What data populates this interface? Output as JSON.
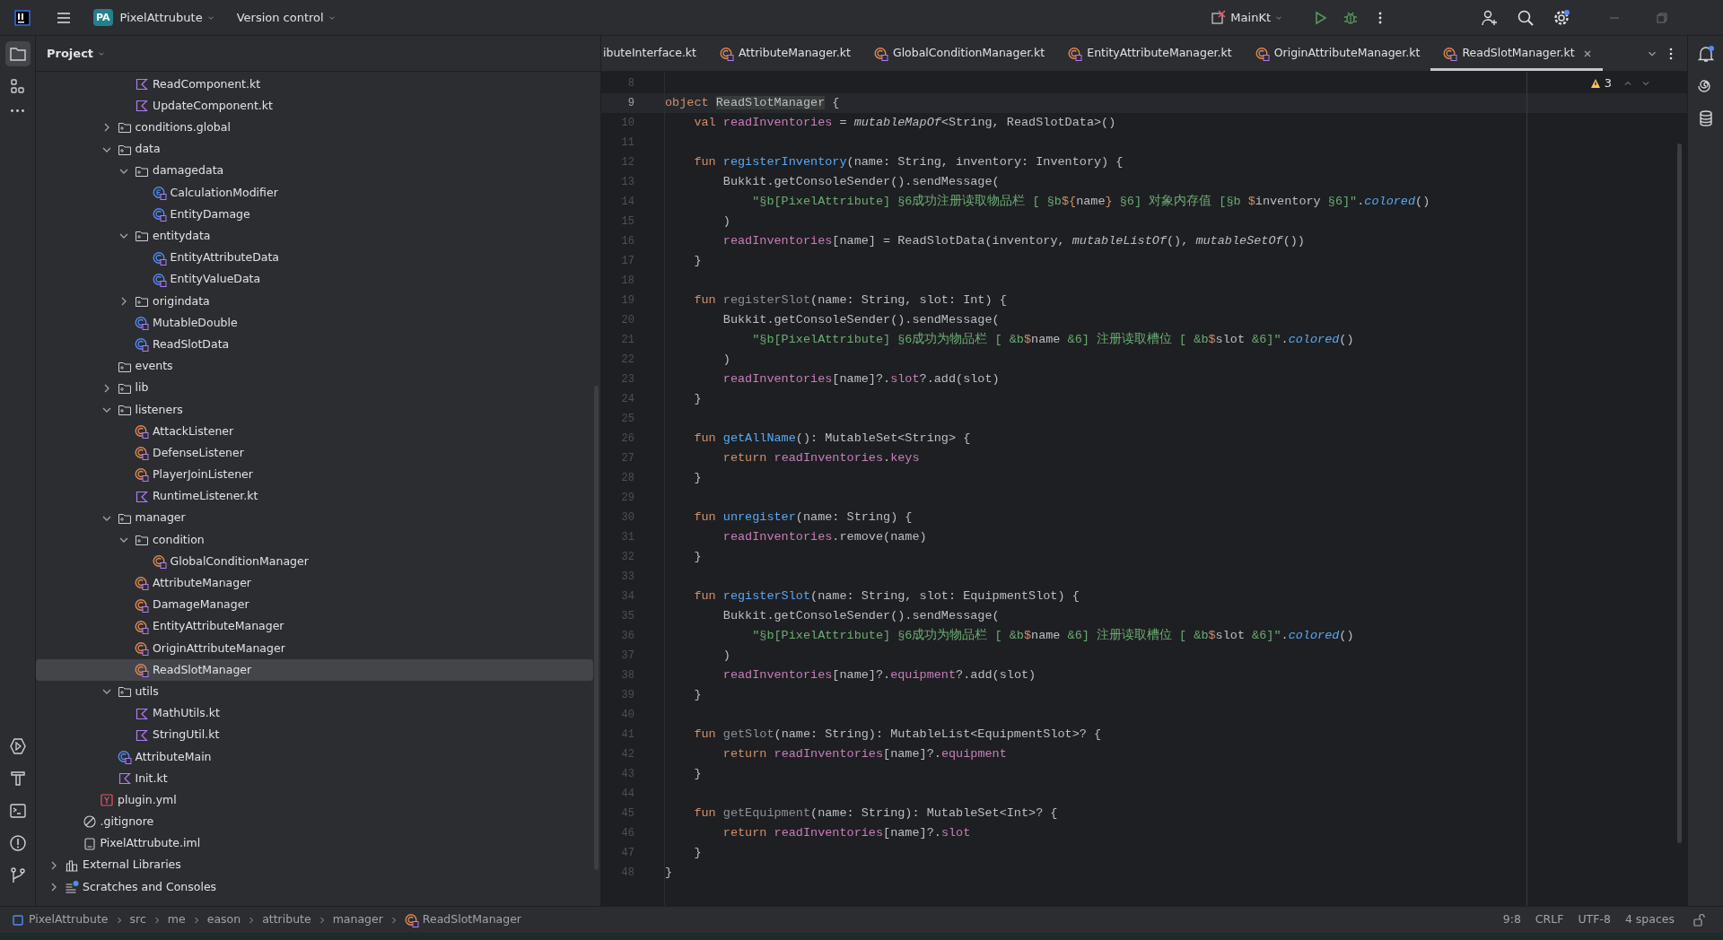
{
  "title_bar": {
    "project_badge": "PA",
    "project_name": "PixelAttrubute",
    "vcs": "Version control",
    "run_config": "MainKt",
    "settings_badge": true
  },
  "tool_strip": {
    "top": [
      {
        "kind": "project",
        "selected": true
      },
      {
        "kind": "structure",
        "selected": false
      },
      {
        "kind": "more",
        "selected": false
      }
    ],
    "bottom": [
      {
        "kind": "run",
        "selected": false
      },
      {
        "kind": "build",
        "selected": false
      },
      {
        "kind": "terminal",
        "selected": false
      },
      {
        "kind": "problems",
        "selected": false
      },
      {
        "kind": "git",
        "selected": false
      }
    ]
  },
  "project_panel": {
    "title": "Project",
    "tree": [
      {
        "children": [
          {
            "children": [
              {
                "children": [
                  {
                    "children": [
                      {
                        "label": "ReadComponent.kt",
                        "kind": "kotlin",
                        "selected": false
                      },
                      {
                        "label": "UpdateComponent.kt",
                        "kind": "kotlin",
                        "selected": false
                      }
                    ]
                  },
                  {
                    "label": "conditions.global",
                    "kind": "folder",
                    "expanded": false,
                    "selected": false
                  },
                  {
                    "label": "data",
                    "kind": "folder",
                    "expanded": true,
                    "selected": false,
                    "children": [
                      {
                        "label": "damagedata",
                        "kind": "folder",
                        "expanded": true,
                        "selected": false,
                        "children": [
                          {
                            "label": "CalculationModifier",
                            "kind": "enum",
                            "selected": false
                          },
                          {
                            "label": "EntityDamage",
                            "kind": "class",
                            "selected": false
                          }
                        ]
                      },
                      {
                        "label": "entitydata",
                        "kind": "folder",
                        "expanded": true,
                        "selected": false,
                        "children": [
                          {
                            "label": "EntityAttributeData",
                            "kind": "class",
                            "selected": false
                          },
                          {
                            "label": "EntityValueData",
                            "kind": "class",
                            "selected": false
                          }
                        ]
                      },
                      {
                        "label": "origindata",
                        "kind": "folder",
                        "expanded": false,
                        "selected": false
                      },
                      {
                        "label": "MutableDouble",
                        "kind": "class",
                        "selected": false
                      },
                      {
                        "label": "ReadSlotData",
                        "kind": "class",
                        "selected": false
                      }
                    ]
                  },
                  {
                    "label": "events",
                    "kind": "folder",
                    "selected": false
                  },
                  {
                    "label": "lib",
                    "kind": "folder",
                    "expanded": false,
                    "selected": false
                  },
                  {
                    "label": "listeners",
                    "kind": "folder",
                    "expanded": true,
                    "selected": false,
                    "children": [
                      {
                        "label": "AttackListener",
                        "kind": "object",
                        "selected": false
                      },
                      {
                        "label": "DefenseListener",
                        "kind": "object",
                        "selected": false
                      },
                      {
                        "label": "PlayerJoinListener",
                        "kind": "object",
                        "selected": false
                      },
                      {
                        "label": "RuntimeListener.kt",
                        "kind": "kotlin",
                        "selected": false
                      }
                    ]
                  },
                  {
                    "label": "manager",
                    "kind": "folder",
                    "expanded": true,
                    "selected": false,
                    "children": [
                      {
                        "label": "condition",
                        "kind": "folder",
                        "expanded": true,
                        "selected": false,
                        "children": [
                          {
                            "label": "GlobalConditionManager",
                            "kind": "object",
                            "selected": false
                          }
                        ]
                      },
                      {
                        "label": "AttributeManager",
                        "kind": "object",
                        "selected": false
                      },
                      {
                        "label": "DamageManager",
                        "kind": "object",
                        "selected": false
                      },
                      {
                        "label": "EntityAttributeManager",
                        "kind": "object",
                        "selected": false
                      },
                      {
                        "label": "OriginAttributeManager",
                        "kind": "object",
                        "selected": false
                      },
                      {
                        "label": "ReadSlotManager",
                        "kind": "object",
                        "selected": true
                      }
                    ]
                  },
                  {
                    "label": "utils",
                    "kind": "folder",
                    "expanded": true,
                    "selected": false,
                    "children": [
                      {
                        "label": "MathUtils.kt",
                        "kind": "kotlin",
                        "selected": false
                      },
                      {
                        "label": "StringUtil.kt",
                        "kind": "kotlin",
                        "selected": false
                      }
                    ]
                  },
                  {
                    "label": "AttributeMain",
                    "kind": "class",
                    "selected": false
                  },
                  {
                    "label": "Init.kt",
                    "kind": "kotlin",
                    "selected": false
                  }
                ]
              },
              {
                "label": "plugin.yml",
                "kind": "yml",
                "selected": false
              }
            ]
          },
          {
            "label": ".gitignore",
            "kind": "ignore",
            "selected": false
          },
          {
            "label": "PixelAttrubute.iml",
            "kind": "iml",
            "selected": false
          }
        ]
      },
      {
        "label": "External Libraries",
        "kind": "libraries",
        "expanded": false,
        "selected": false
      },
      {
        "label": "Scratches and Consoles",
        "kind": "scratches",
        "expanded": false,
        "selected": false
      }
    ]
  },
  "editor": {
    "tabs": [
      {
        "label": "ibuteInterface.kt",
        "selected": false
      },
      {
        "label": "AttributeManager.kt",
        "kind": "object",
        "selected": false
      },
      {
        "label": "GlobalConditionManager.kt",
        "kind": "object",
        "selected": false
      },
      {
        "label": "EntityAttributeManager.kt",
        "kind": "object",
        "selected": false
      },
      {
        "label": "OriginAttributeManager.kt",
        "kind": "object",
        "selected": false
      },
      {
        "label": "ReadSlotManager.kt",
        "kind": "object",
        "selected": true
      }
    ],
    "warnings": "3",
    "lines": [
      {
        "number": "8",
        "current": false
      },
      {
        "number": "9",
        "current": true,
        "tokens": [
          {
            "text": "object ",
            "kind": "keyword"
          },
          {
            "text": "ReadSlotManager",
            "kind": "declared"
          },
          {
            "text": " {",
            "kind": "plain"
          }
        ]
      },
      {
        "number": "10",
        "current": false,
        "tokens": [
          {
            "text": "    val ",
            "kind": "keyword"
          },
          {
            "text": "readInventories",
            "kind": "property"
          },
          {
            "text": " = ",
            "kind": "plain"
          },
          {
            "text": "mutableMapOf",
            "kind": "italic"
          },
          {
            "text": "<String, ReadSlotData>()",
            "kind": "plain"
          }
        ]
      },
      {
        "number": "11",
        "current": false
      },
      {
        "number": "12",
        "current": false,
        "tokens": [
          {
            "text": "    fun ",
            "kind": "keyword"
          },
          {
            "text": "registerInventory",
            "kind": "function"
          },
          {
            "text": "(name: String, inventory: Inventory) {",
            "kind": "plain"
          }
        ]
      },
      {
        "number": "13",
        "current": false,
        "tokens": [
          {
            "text": "        Bukkit.getConsoleSender().sendMessage(",
            "kind": "plain"
          }
        ]
      },
      {
        "number": "14",
        "current": false,
        "tokens": [
          {
            "text": "            \"§b[PixelAttribute] §6成功注册读取物品栏 [ §b",
            "kind": "string"
          },
          {
            "text": "${",
            "kind": "template"
          },
          {
            "text": "name",
            "kind": "plain"
          },
          {
            "text": "}",
            "kind": "template"
          },
          {
            "text": " §6] 对象内存值 [§b ",
            "kind": "string"
          },
          {
            "text": "$",
            "kind": "template"
          },
          {
            "text": "inventory",
            "kind": "plain"
          },
          {
            "text": " §6]\"",
            "kind": "string"
          },
          {
            "text": ".",
            "kind": "plain"
          },
          {
            "text": "colored",
            "kind": "call"
          },
          {
            "text": "()",
            "kind": "plain"
          }
        ]
      },
      {
        "number": "15",
        "current": false,
        "tokens": [
          {
            "text": "        )",
            "kind": "plain"
          }
        ]
      },
      {
        "number": "16",
        "current": false,
        "tokens": [
          {
            "text": "        readInventories",
            "kind": "property"
          },
          {
            "text": "[name] = ReadSlotData(inventory, ",
            "kind": "plain"
          },
          {
            "text": "mutableListOf",
            "kind": "italic"
          },
          {
            "text": "(), ",
            "kind": "plain"
          },
          {
            "text": "mutableSetOf",
            "kind": "italic"
          },
          {
            "text": "())",
            "kind": "plain"
          }
        ]
      },
      {
        "number": "17",
        "current": false,
        "tokens": [
          {
            "text": "    }",
            "kind": "plain"
          }
        ]
      },
      {
        "number": "18",
        "current": false
      },
      {
        "number": "19",
        "current": false,
        "tokens": [
          {
            "text": "    fun ",
            "kind": "keyword"
          },
          {
            "text": "registerSlot",
            "kind": "unused"
          },
          {
            "text": "(name: String, slot: Int) {",
            "kind": "plain"
          }
        ]
      },
      {
        "number": "20",
        "current": false,
        "tokens": [
          {
            "text": "        Bukkit.getConsoleSender().sendMessage(",
            "kind": "plain"
          }
        ]
      },
      {
        "number": "21",
        "current": false,
        "tokens": [
          {
            "text": "            \"§b[PixelAttribute] §6成功为物品栏 [ &b",
            "kind": "string"
          },
          {
            "text": "$",
            "kind": "template"
          },
          {
            "text": "name",
            "kind": "plain"
          },
          {
            "text": " &6] 注册读取槽位 [ &b",
            "kind": "string"
          },
          {
            "text": "$",
            "kind": "template"
          },
          {
            "text": "slot",
            "kind": "plain"
          },
          {
            "text": " &6]\"",
            "kind": "string"
          },
          {
            "text": ".",
            "kind": "plain"
          },
          {
            "text": "colored",
            "kind": "call"
          },
          {
            "text": "()",
            "kind": "plain"
          }
        ]
      },
      {
        "number": "22",
        "current": false,
        "tokens": [
          {
            "text": "        )",
            "kind": "plain"
          }
        ]
      },
      {
        "number": "23",
        "current": false,
        "tokens": [
          {
            "text": "        readInventories",
            "kind": "property"
          },
          {
            "text": "[name]?.",
            "kind": "plain"
          },
          {
            "text": "slot",
            "kind": "property"
          },
          {
            "text": "?.add(slot)",
            "kind": "plain"
          }
        ]
      },
      {
        "number": "24",
        "current": false,
        "tokens": [
          {
            "text": "    }",
            "kind": "plain"
          }
        ]
      },
      {
        "number": "25",
        "current": false
      },
      {
        "number": "26",
        "current": false,
        "tokens": [
          {
            "text": "    fun ",
            "kind": "keyword"
          },
          {
            "text": "getAllName",
            "kind": "function"
          },
          {
            "text": "(): MutableSet<String> {",
            "kind": "plain"
          }
        ]
      },
      {
        "number": "27",
        "current": false,
        "tokens": [
          {
            "text": "        return ",
            "kind": "keyword"
          },
          {
            "text": "readInventories",
            "kind": "property"
          },
          {
            "text": ".",
            "kind": "plain"
          },
          {
            "text": "keys",
            "kind": "property"
          }
        ]
      },
      {
        "number": "28",
        "current": false,
        "tokens": [
          {
            "text": "    }",
            "kind": "plain"
          }
        ]
      },
      {
        "number": "29",
        "current": false
      },
      {
        "number": "30",
        "current": false,
        "tokens": [
          {
            "text": "    fun ",
            "kind": "keyword"
          },
          {
            "text": "unregister",
            "kind": "function"
          },
          {
            "text": "(name: String) {",
            "kind": "plain"
          }
        ]
      },
      {
        "number": "31",
        "current": false,
        "tokens": [
          {
            "text": "        readInventories",
            "kind": "property"
          },
          {
            "text": ".remove(name)",
            "kind": "plain"
          }
        ]
      },
      {
        "number": "32",
        "current": false,
        "tokens": [
          {
            "text": "    }",
            "kind": "plain"
          }
        ]
      },
      {
        "number": "33",
        "current": false
      },
      {
        "number": "34",
        "current": false,
        "tokens": [
          {
            "text": "    fun ",
            "kind": "keyword"
          },
          {
            "text": "registerSlot",
            "kind": "function"
          },
          {
            "text": "(name: String, slot: EquipmentSlot) {",
            "kind": "plain"
          }
        ]
      },
      {
        "number": "35",
        "current": false,
        "tokens": [
          {
            "text": "        Bukkit.getConsoleSender().sendMessage(",
            "kind": "plain"
          }
        ]
      },
      {
        "number": "36",
        "current": false,
        "tokens": [
          {
            "text": "            \"§b[PixelAttribute] §6成功为物品栏 [ &b",
            "kind": "string"
          },
          {
            "text": "$",
            "kind": "template"
          },
          {
            "text": "name",
            "kind": "plain"
          },
          {
            "text": " &6] 注册读取槽位 [ &b",
            "kind": "string"
          },
          {
            "text": "$",
            "kind": "template"
          },
          {
            "text": "slot",
            "kind": "plain"
          },
          {
            "text": " &6]\"",
            "kind": "string"
          },
          {
            "text": ".",
            "kind": "plain"
          },
          {
            "text": "colored",
            "kind": "call"
          },
          {
            "text": "()",
            "kind": "plain"
          }
        ]
      },
      {
        "number": "37",
        "current": false,
        "tokens": [
          {
            "text": "        )",
            "kind": "plain"
          }
        ]
      },
      {
        "number": "38",
        "current": false,
        "tokens": [
          {
            "text": "        readInventories",
            "kind": "property"
          },
          {
            "text": "[name]?.",
            "kind": "plain"
          },
          {
            "text": "equipment",
            "kind": "property"
          },
          {
            "text": "?.add(slot)",
            "kind": "plain"
          }
        ]
      },
      {
        "number": "39",
        "current": false,
        "tokens": [
          {
            "text": "    }",
            "kind": "plain"
          }
        ]
      },
      {
        "number": "40",
        "current": false
      },
      {
        "number": "41",
        "current": false,
        "tokens": [
          {
            "text": "    fun ",
            "kind": "keyword"
          },
          {
            "text": "getSlot",
            "kind": "unused"
          },
          {
            "text": "(name: String): MutableList<EquipmentSlot>? {",
            "kind": "plain"
          }
        ]
      },
      {
        "number": "42",
        "current": false,
        "tokens": [
          {
            "text": "        return ",
            "kind": "keyword"
          },
          {
            "text": "readInventories",
            "kind": "property"
          },
          {
            "text": "[name]?.",
            "kind": "plain"
          },
          {
            "text": "equipment",
            "kind": "property"
          }
        ]
      },
      {
        "number": "43",
        "current": false,
        "tokens": [
          {
            "text": "    }",
            "kind": "plain"
          }
        ]
      },
      {
        "number": "44",
        "current": false
      },
      {
        "number": "45",
        "current": false,
        "tokens": [
          {
            "text": "    fun ",
            "kind": "keyword"
          },
          {
            "text": "getEquipment",
            "kind": "unused"
          },
          {
            "text": "(name: String): MutableSet<Int>? {",
            "kind": "plain"
          }
        ]
      },
      {
        "number": "46",
        "current": false,
        "tokens": [
          {
            "text": "        return ",
            "kind": "keyword"
          },
          {
            "text": "readInventories",
            "kind": "property"
          },
          {
            "text": "[name]?.",
            "kind": "plain"
          },
          {
            "text": "slot",
            "kind": "property"
          }
        ]
      },
      {
        "number": "47",
        "current": false,
        "tokens": [
          {
            "text": "    }",
            "kind": "plain"
          }
        ]
      },
      {
        "number": "48",
        "current": false,
        "tokens": [
          {
            "text": "}",
            "kind": "plain"
          }
        ]
      }
    ]
  },
  "right_strip": {
    "notifications_badge": true
  },
  "status_bar": {
    "breadcrumbs": [
      {
        "label": "PixelAttrubute",
        "kind": "module"
      },
      {
        "label": "src"
      },
      {
        "label": "me"
      },
      {
        "label": "eason"
      },
      {
        "label": "attribute"
      },
      {
        "label": "manager"
      },
      {
        "label": "ReadSlotManager",
        "kind": "object"
      }
    ],
    "items": [
      "9:8",
      "CRLF",
      "UTF-8",
      "4 spaces"
    ]
  }
}
